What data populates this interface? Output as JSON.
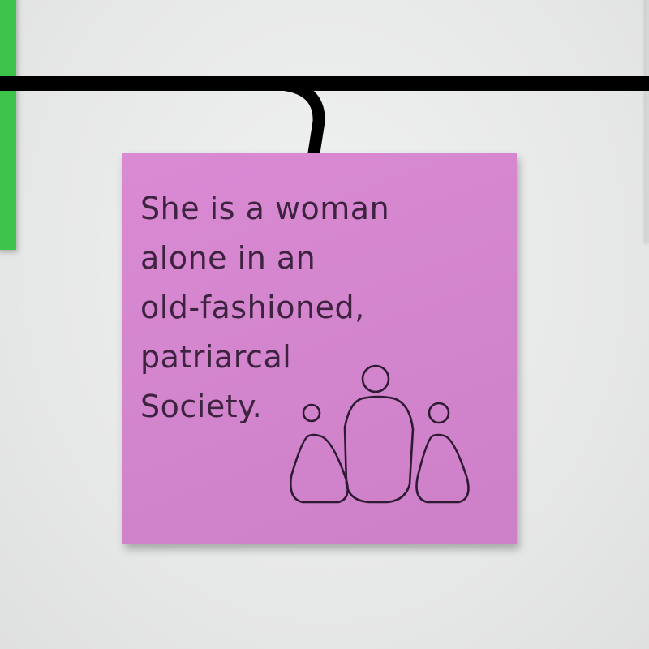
{
  "note": {
    "color": "#d487ce",
    "lines": [
      "She is a woman",
      "alone in an",
      "old-fashioned,",
      "patriarcal",
      "Society."
    ]
  },
  "drawing": {
    "figures": [
      "small-triangle-person",
      "tall-person",
      "small-triangle-person"
    ]
  },
  "background": {
    "board_color": "#e9eaea",
    "connector_color": "#000000",
    "neighbor_note_color": "#3cc34a"
  }
}
